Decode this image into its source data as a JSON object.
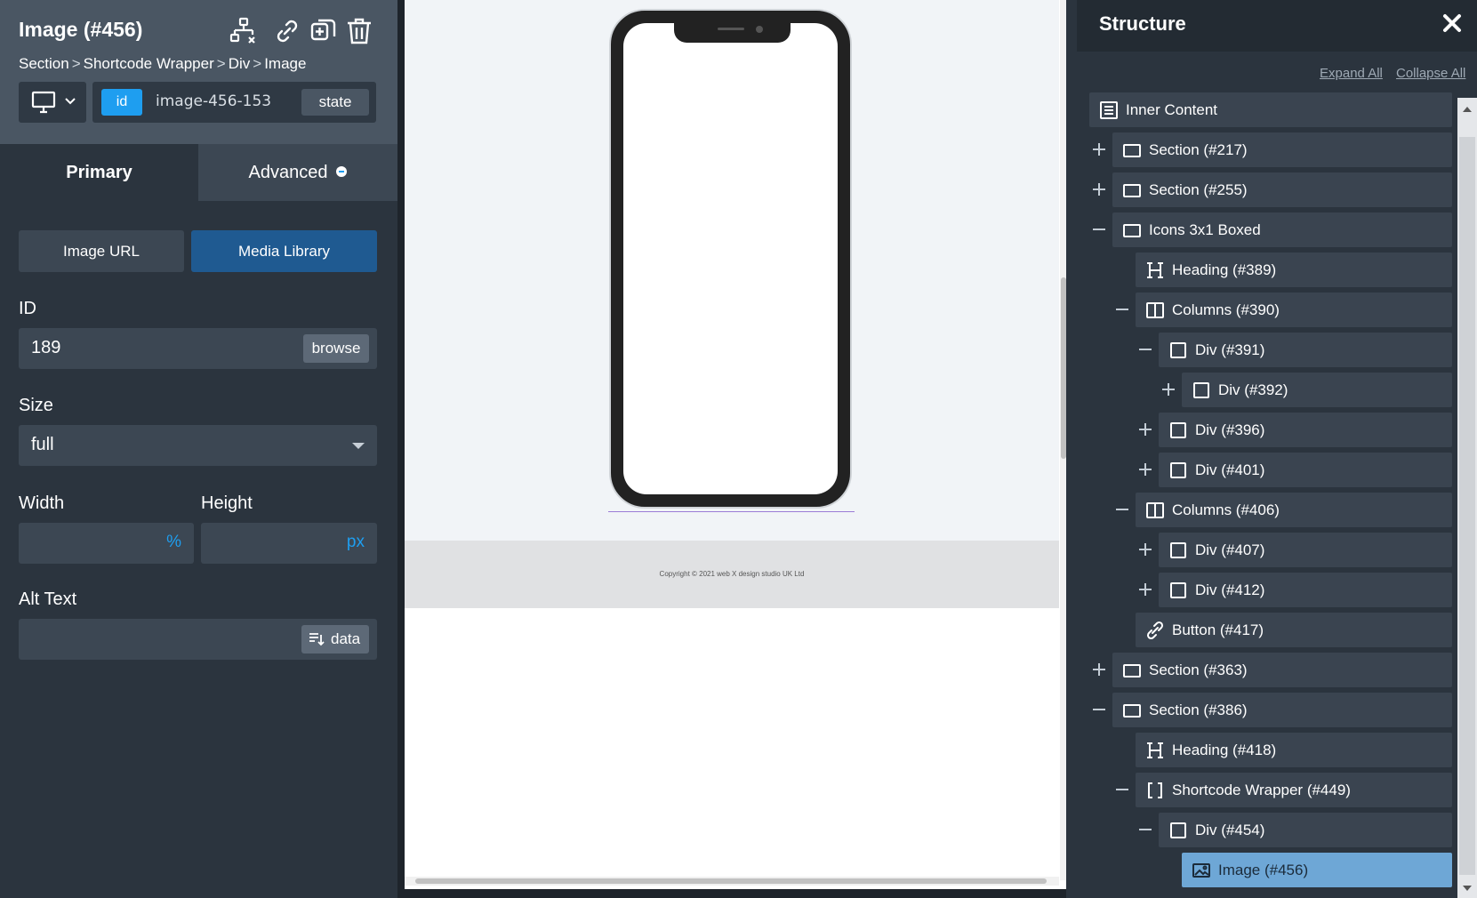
{
  "left_panel": {
    "title": "Image (#456)",
    "breadcrumb": [
      "Section",
      "Shortcode Wrapper",
      "Div",
      "Image"
    ],
    "breadcrumb_sep": ">",
    "id_badge": "id",
    "id_value": "image-456-153",
    "state_label": "state",
    "tabs": {
      "primary": "Primary",
      "advanced": "Advanced"
    },
    "source_buttons": {
      "image_url": "Image URL",
      "media_library": "Media Library"
    },
    "fields": {
      "id_label": "ID",
      "id_value": "189",
      "browse_label": "browse",
      "size_label": "Size",
      "size_value": "full",
      "width_label": "Width",
      "width_unit": "%",
      "height_label": "Height",
      "height_unit": "px",
      "alt_label": "Alt Text",
      "data_label": "data"
    }
  },
  "canvas": {
    "copyright": "Copyright © 2021 web X design studio UK Ltd"
  },
  "structure": {
    "title": "Structure",
    "expand_all": "Expand All",
    "collapse_all": "Collapse All",
    "items": [
      {
        "label": "Inner Content",
        "icon": "document-icon"
      },
      {
        "label": "Section (#217)",
        "icon": "section-icon",
        "toggle": "plus"
      },
      {
        "label": "Section (#255)",
        "icon": "section-icon",
        "toggle": "plus"
      },
      {
        "label": "Icons 3x1 Boxed",
        "icon": "section-icon",
        "toggle": "minus"
      },
      {
        "label": "Heading (#389)",
        "icon": "heading-icon"
      },
      {
        "label": "Columns (#390)",
        "icon": "columns-icon",
        "toggle": "minus"
      },
      {
        "label": "Div (#391)",
        "icon": "div-icon",
        "toggle": "minus"
      },
      {
        "label": "Div (#392)",
        "icon": "div-icon",
        "toggle": "plus"
      },
      {
        "label": "Div (#396)",
        "icon": "div-icon",
        "toggle": "plus"
      },
      {
        "label": "Div (#401)",
        "icon": "div-icon",
        "toggle": "plus"
      },
      {
        "label": "Columns (#406)",
        "icon": "columns-icon",
        "toggle": "minus"
      },
      {
        "label": "Div (#407)",
        "icon": "div-icon",
        "toggle": "plus"
      },
      {
        "label": "Div (#412)",
        "icon": "div-icon",
        "toggle": "plus"
      },
      {
        "label": "Button (#417)",
        "icon": "link-icon"
      },
      {
        "label": "Section (#363)",
        "icon": "section-icon",
        "toggle": "plus"
      },
      {
        "label": "Section (#386)",
        "icon": "section-icon",
        "toggle": "minus"
      },
      {
        "label": "Heading (#418)",
        "icon": "heading-icon"
      },
      {
        "label": "Shortcode Wrapper (#449)",
        "icon": "brackets-icon",
        "toggle": "minus"
      },
      {
        "label": "Div (#454)",
        "icon": "div-icon",
        "toggle": "minus"
      },
      {
        "label": "Image (#456)",
        "icon": "image-icon",
        "selected": true
      }
    ]
  },
  "colors": {
    "accent": "#1e9ef0",
    "media_library_active": "#1f5a91",
    "selected_row": "#6ea7d6",
    "panel_bg": "#2b343e"
  }
}
